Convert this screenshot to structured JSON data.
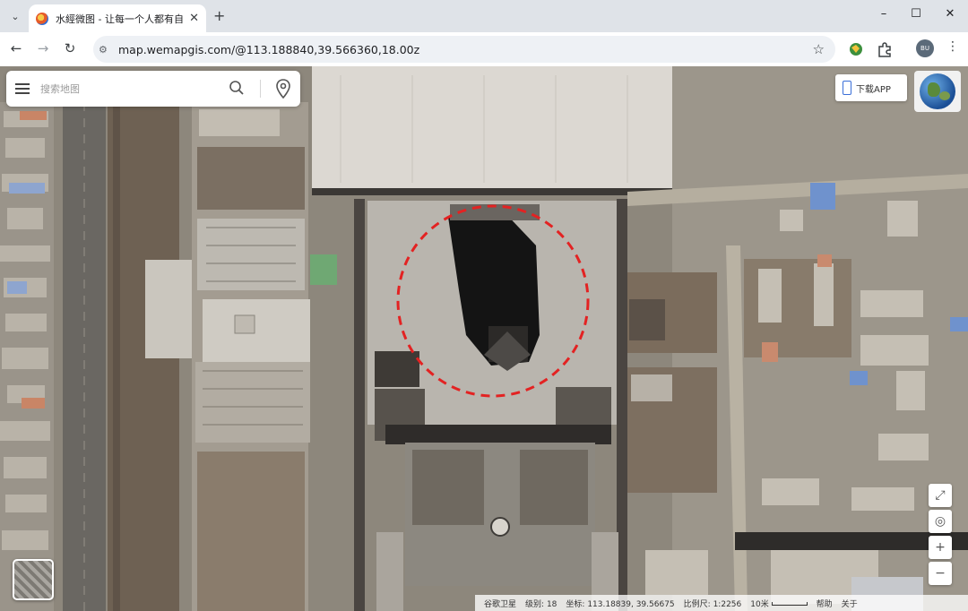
{
  "browser": {
    "tab_title": "水經微图 - 让每一个人都有自己",
    "url": "map.wemapgis.com/@113.188840,39.566360,18.00z",
    "profile_initials": "BU"
  },
  "map": {
    "search_placeholder": "搜索地图",
    "download_app_label": "下载APP",
    "status": {
      "source": "谷歌卫星",
      "level_label": "级别:",
      "level_value": "18",
      "coord_label": "坐标:",
      "coord_value": "113.18839, 39.56675",
      "scale_label": "比例尺:",
      "scale_value": "1:2256",
      "scale_bar_label": "10米",
      "help": "帮助",
      "about": "关于"
    },
    "highlight_color": "#e32222"
  }
}
